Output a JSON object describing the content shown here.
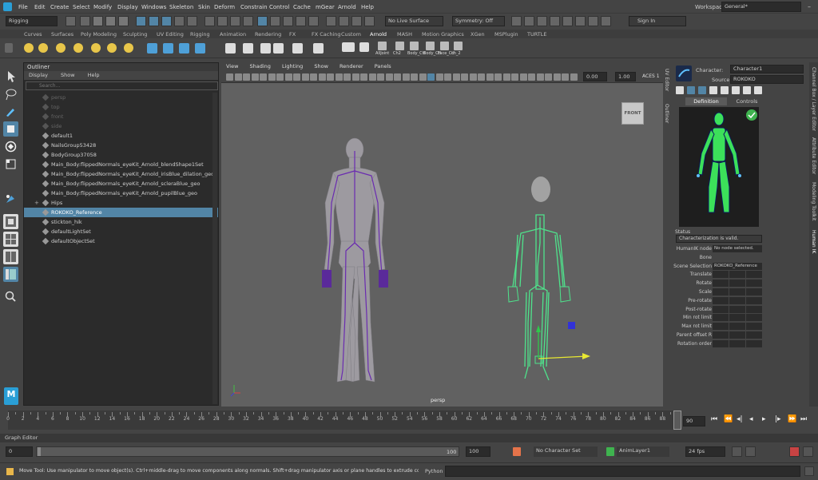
{
  "menubar": {
    "items": [
      "File",
      "Edit",
      "Create",
      "Select",
      "Modify",
      "Display",
      "Windows",
      "Skeleton",
      "Skin",
      "Deform",
      "Constrain",
      "Control",
      "Cache",
      "mGear",
      "Arnold",
      "Help"
    ],
    "workspace_label": "Workspace :",
    "workspace_value": "General*"
  },
  "statusline": {
    "mode": "Rigging",
    "live_surface": "No Live Surface",
    "symmetry": "Symmetry: Off",
    "sign_in": "Sign In"
  },
  "shelf": {
    "tabs": [
      "Curves",
      "Surfaces",
      "Poly Modeling",
      "Sculpting",
      "UV Editing",
      "Rigging",
      "Animation",
      "Rendering",
      "FX",
      "FX Caching",
      "Custom",
      "Arnold",
      "MASH",
      "Motion Graphics",
      "XGen",
      "MSPlugin",
      "TURTLE"
    ],
    "active_tab": "Arnold",
    "custom_buttons": [
      "AllJoint",
      "Ch2",
      "Body_Ctl",
      "Body_Ctl",
      "Face_Ctl",
      "ch_2"
    ]
  },
  "outliner": {
    "title": "Outliner",
    "menu": [
      "Display",
      "Show",
      "Help"
    ],
    "search_placeholder": "Search...",
    "rows": [
      {
        "label": "persp",
        "dim": true,
        "selected": false,
        "expand": ""
      },
      {
        "label": "top",
        "dim": true,
        "selected": false,
        "expand": ""
      },
      {
        "label": "front",
        "dim": true,
        "selected": false,
        "expand": ""
      },
      {
        "label": "side",
        "dim": true,
        "selected": false,
        "expand": ""
      },
      {
        "label": "default1",
        "dim": false,
        "selected": false,
        "expand": ""
      },
      {
        "label": "NailsGroup53428",
        "dim": false,
        "selected": false,
        "expand": ""
      },
      {
        "label": "BodyGroup37058",
        "dim": false,
        "selected": false,
        "expand": ""
      },
      {
        "label": "Main_Body:flippedNormals_eyeKit_Arnold_blendShape1Set",
        "dim": false,
        "selected": false,
        "expand": ""
      },
      {
        "label": "Main_Body:flippedNormals_eyeKit_Arnold_irisBlue_dilation_geo",
        "dim": false,
        "selected": false,
        "expand": ""
      },
      {
        "label": "Main_Body:flippedNormals_eyeKit_Arnold_scleraBlue_geo",
        "dim": false,
        "selected": false,
        "expand": ""
      },
      {
        "label": "Main_Body:flippedNormals_eyeKit_Arnold_pupilBlue_geo",
        "dim": false,
        "selected": false,
        "expand": ""
      },
      {
        "label": "Hips",
        "dim": false,
        "selected": false,
        "expand": "+"
      },
      {
        "label": "ROKOKO_Reference",
        "dim": false,
        "selected": true,
        "expand": ""
      },
      {
        "label": "stickton_hik",
        "dim": false,
        "selected": false,
        "expand": ""
      },
      {
        "label": "defaultLightSet",
        "dim": false,
        "selected": false,
        "expand": ""
      },
      {
        "label": "defaultObjectSet",
        "dim": false,
        "selected": false,
        "expand": ""
      }
    ]
  },
  "viewport": {
    "menu": [
      "View",
      "Shading",
      "Lighting",
      "Show",
      "Renderer",
      "Panels"
    ],
    "field1": "0.00",
    "field2": "1.00",
    "colorspace": "ACES 1",
    "view_cube": "FRONT",
    "camera": "persp",
    "left_tab": "UV Editor",
    "right_tab": "Outliner"
  },
  "hik": {
    "character_label": "Character:",
    "character_value": "Character1",
    "source_label": "Source:",
    "source_value": "ROKOKO",
    "tabs": [
      "Definition",
      "Controls"
    ],
    "status_title": "Status",
    "status_value": "Characterization is valid.",
    "props": [
      {
        "label": "HumanIK node",
        "value": "No node selected."
      },
      {
        "label": "Bone",
        "value": ""
      },
      {
        "label": "Scene Selection",
        "value": "ROKOKO_Reference"
      },
      {
        "label": "Translate",
        "value": ""
      },
      {
        "label": "Rotate",
        "value": ""
      },
      {
        "label": "Scale",
        "value": ""
      },
      {
        "label": "Pre-rotate",
        "value": ""
      },
      {
        "label": "Post-rotate",
        "value": ""
      },
      {
        "label": "Min rot limit",
        "value": ""
      },
      {
        "label": "Max rot limit",
        "value": ""
      },
      {
        "label": "Parent offset R",
        "value": ""
      },
      {
        "label": "Rotation order",
        "value": ""
      }
    ]
  },
  "right_strip": [
    "Channel Box / Layer Editor",
    "Attribute Editor",
    "Modeling Toolkit",
    "Human IK"
  ],
  "timeline": {
    "start": 0,
    "end": 90,
    "step": 2,
    "current_frame": "90",
    "current_marker": 90
  },
  "graph_editor_label": "Graph Editor",
  "range": {
    "start": "0",
    "inner_start": "0",
    "inner_end": "100",
    "end": "100",
    "playback_end_label": "100",
    "char_set": "No Character Set",
    "anim_layer": "AnimLayer1",
    "fps": "24 fps"
  },
  "helpline": {
    "text": "Move Tool: Use manipulator to move object(s). Ctrl+middle-drag to move components along normals. Shift+drag manipulator axis or plane handles to extrude components or clone objects.",
    "python": "Python"
  },
  "colors": {
    "selection": "#5285a6",
    "skeleton_green": "#4fe38c",
    "skeleton_purple": "#6a2bb0",
    "panel_bg": "#444444"
  }
}
